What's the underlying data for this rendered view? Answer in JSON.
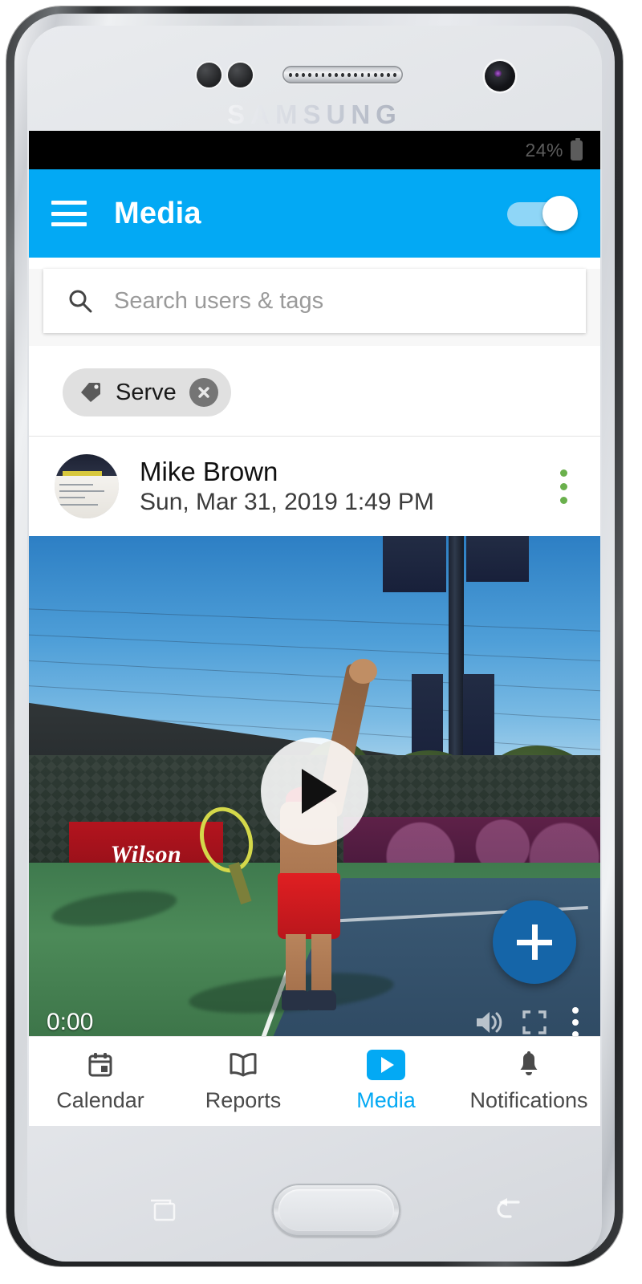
{
  "device": {
    "brand": "SAMSUNG",
    "hardware": {
      "earpiece": "earpiece-speaker",
      "front_camera": "front-camera-icon",
      "proximity_sensor": "proximity-sensor",
      "light_sensor": "light-sensor",
      "home_button": "home-button",
      "recents_button": "recents-icon",
      "back_button": "back-icon"
    }
  },
  "status_bar": {
    "battery_percent": "24%",
    "battery_icon": "battery-icon"
  },
  "app_bar": {
    "menu_icon": "hamburger-menu-icon",
    "title": "Media",
    "toggle_state": "on",
    "accent_color": "#03a9f4"
  },
  "search": {
    "icon": "search-icon",
    "placeholder": "Search users & tags",
    "value": ""
  },
  "filters": {
    "chips": [
      {
        "label": "Serve",
        "icon": "tag-icon",
        "remove_icon": "close-icon"
      }
    ]
  },
  "post": {
    "avatar": "user-avatar",
    "author": "Mike Brown",
    "timestamp": "Sun, Mar 31, 2019 1:49 PM",
    "menu_icon": "overflow-menu-icon",
    "menu_color": "#6ab04c"
  },
  "video": {
    "current_time": "0:00",
    "play_icon": "play-button-icon",
    "volume_icon": "volume-icon",
    "fullscreen_icon": "fullscreen-icon",
    "menu_icon": "video-overflow-icon",
    "scene_banner": "Wilson"
  },
  "fab": {
    "icon": "plus-icon",
    "color": "#1565a8"
  },
  "bottom_nav": {
    "items": [
      {
        "label": "Calendar",
        "icon": "calendar-icon",
        "active": false
      },
      {
        "label": "Reports",
        "icon": "book-icon",
        "active": false
      },
      {
        "label": "Media",
        "icon": "play-icon",
        "active": true
      },
      {
        "label": "Notifications",
        "icon": "bell-icon",
        "active": false
      }
    ]
  }
}
